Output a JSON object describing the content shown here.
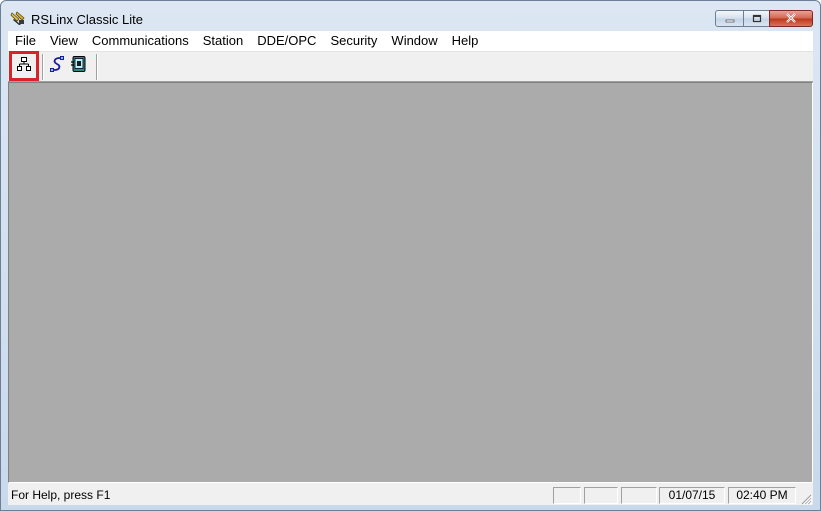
{
  "window": {
    "title": "RSLinx Classic Lite",
    "caption_buttons": [
      "minimize-icon",
      "maximize-icon",
      "close-icon"
    ]
  },
  "menu": {
    "items": [
      "File",
      "View",
      "Communications",
      "Station",
      "DDE/OPC",
      "Security",
      "Window",
      "Help"
    ]
  },
  "toolbar": {
    "buttons": [
      {
        "icon": "rswho-network-icon",
        "highlighted": true
      },
      {
        "icon": "configure-drivers-icon",
        "highlighted": false
      },
      {
        "icon": "configure-shortcuts-icon",
        "highlighted": false
      }
    ]
  },
  "statusbar": {
    "help_text": "For Help, press F1",
    "date": "01/07/15",
    "time": "02:40 PM"
  },
  "colors": {
    "workspace": "#ababab",
    "highlight": "#d9232b",
    "close_button": "#c0391f"
  }
}
